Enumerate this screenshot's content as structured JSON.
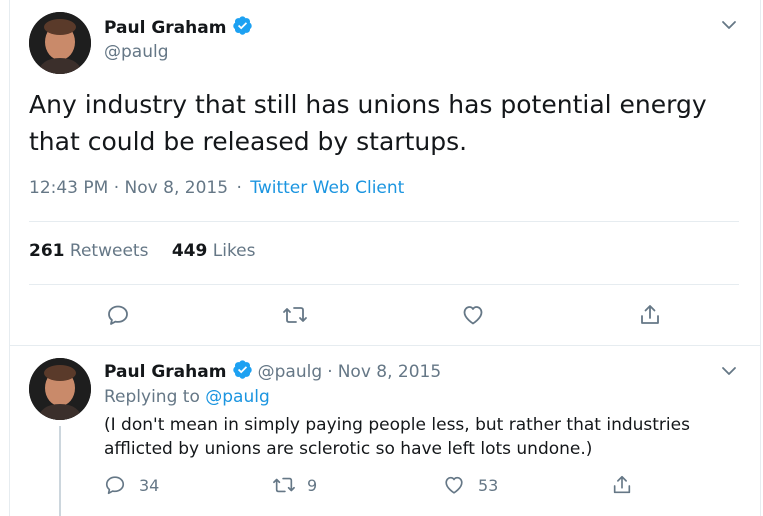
{
  "main_tweet": {
    "author_name": "Paul Graham",
    "handle": "@paulg",
    "text": "Any industry that still has unions has potential energy that could be released by startups.",
    "time": "12:43 PM",
    "date": "Nov 8, 2015",
    "separator": "·",
    "source": "Twitter Web Client",
    "retweets_count": "261",
    "retweets_label": "Retweets",
    "likes_count": "449",
    "likes_label": "Likes"
  },
  "reply_tweet": {
    "author_name": "Paul Graham",
    "handle": "@paulg",
    "separator": "·",
    "date": "Nov 8, 2015",
    "replying_prefix": "Replying to",
    "replying_to": "@paulg",
    "text": "(I don't mean in simply paying people less, but rather that industries afflicted by unions are sclerotic so have left lots undone.)",
    "reply_count": "34",
    "retweet_count": "9",
    "like_count": "53"
  },
  "colors": {
    "accent": "#1b95e0",
    "verified": "#1da1f2",
    "muted": "#657786",
    "text": "#14171a"
  },
  "icons": [
    "verified-badge-icon",
    "chevron-down-icon",
    "reply-icon",
    "retweet-icon",
    "like-icon",
    "share-icon"
  ]
}
